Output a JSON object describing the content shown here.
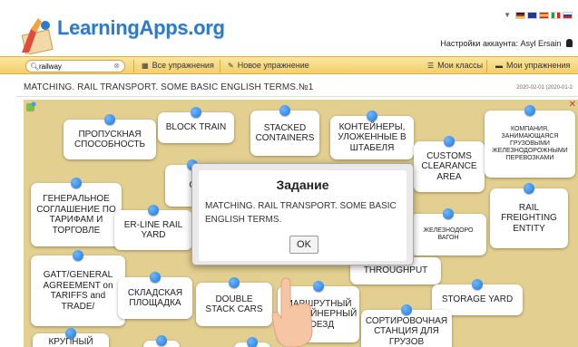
{
  "header": {
    "logo_text": "LearningApps.org",
    "account_label": "Настройки аккаунта:",
    "account_user": "Asyl Ersain",
    "languages": [
      "de",
      "uk",
      "es",
      "it",
      "ru"
    ]
  },
  "navbar": {
    "search_value": "railway",
    "all_exercises": "Все упражнения",
    "new_exercise": "Новое упражнение",
    "my_classes": "Мои классы",
    "my_exercises": "Мои упражнения"
  },
  "page": {
    "title": "MATCHING. RAIL TRANSPORT. SOME BASIC ENGLISH TERMS.№1",
    "date": "2020-02-01 (2020-01-2"
  },
  "cards": {
    "c1": "ПРОПУСКНАЯ СПОСОБНОСТЬ",
    "c2": "BLOCK TRAIN",
    "c3": "STACKED CONTAINERS",
    "c4": "КОНТЕЙНЕРЫ, УЛОЖЕННЫЕ В ШТАБЕЛЯ",
    "c5": "CUSTOMS CLEARANCE AREA",
    "c6": "КОМПАНИЯ, ЗАНИМАЮЩАЯСЯ ГРУЗОВЫМИ ЖЕЛЕЗНОДОРОЖНЫМИ ПЕРЕВОЗКАМИ",
    "c7": "ГЕНЕРАЛЬНОЕ СОГЛАШЕНИЕ ПО ТАРИФАМ И ТОРГОВЛЕ",
    "c8": "ER-LINE RAIL YARD",
    "c9": "C",
    "c10": "ЖЕЛЕЗНОДОРО ВАГОН",
    "c11": "RAIL FREIGHTING ENTITY",
    "c12": "GATT/GENERAL AGREEMENT on TARIFFS and TRADE/",
    "c13": "СКЛАДСКАЯ ПЛОЩАДКА",
    "c14": "DOUBLE STACK CARS",
    "c15": "THROUGHPUT",
    "c16": "МАРШРУТНЫЙ КОНТЕЙНЕРНЫЙ ПОЕЗД",
    "c17": "STORAGE YARD",
    "c18": "СОРТИРОВОЧНАЯ СТАНЦИЯ ДЛЯ ГРУЗОВ",
    "c19": "КРУПНЫЙ"
  },
  "modal": {
    "title": "Задание",
    "text": "MATCHING. RAIL TRANSPORT. SOME BASIC ENGLISH TERMS.",
    "ok_label": "OK"
  },
  "colors": {
    "brand_blue": "#2e7bc4",
    "navbar": "#f2cf6b",
    "board": "#e3cf8f",
    "pin": "#1f74d6"
  }
}
